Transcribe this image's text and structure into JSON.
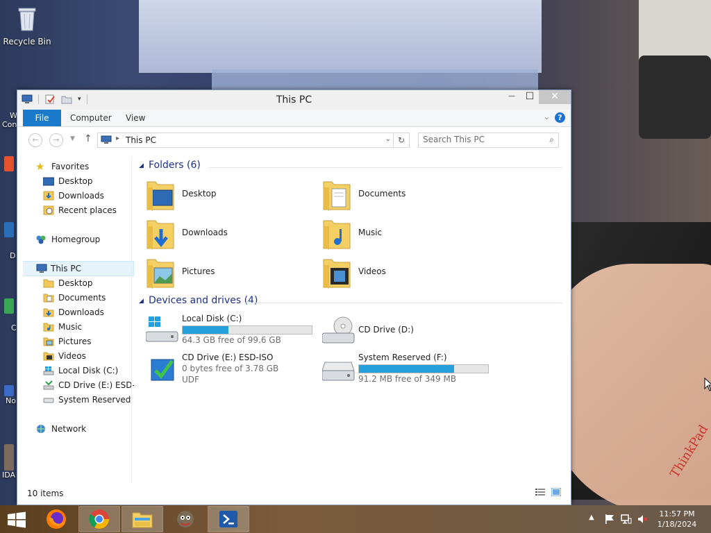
{
  "desktop": {
    "icons": [
      {
        "label": "Recycle Bin"
      }
    ],
    "partial_labels": [
      "W",
      "Con",
      "D",
      "C",
      "No",
      "IDA"
    ],
    "photo_brand": "ThinkPad"
  },
  "window": {
    "title": "This PC",
    "close_glyph": "✕",
    "minimize_glyph": "—",
    "maximize_glyph": "☐"
  },
  "ribbon": {
    "tabs": [
      "File",
      "Computer",
      "View"
    ],
    "help": "?"
  },
  "navbar": {
    "breadcrumb": "This PC",
    "search_placeholder": "Search This PC"
  },
  "nav_pane": {
    "favorites": {
      "label": "Favorites",
      "items": [
        "Desktop",
        "Downloads",
        "Recent places"
      ]
    },
    "homegroup": "Homegroup",
    "this_pc": {
      "label": "This PC",
      "items": [
        "Desktop",
        "Documents",
        "Downloads",
        "Music",
        "Pictures",
        "Videos",
        "Local Disk (C:)",
        "CD Drive (E:) ESD-ISO",
        "System Reserved (F:)"
      ]
    },
    "network": "Network"
  },
  "content": {
    "folders_header": "Folders (6)",
    "folders": [
      "Desktop",
      "Documents",
      "Downloads",
      "Music",
      "Pictures",
      "Videos"
    ],
    "drives_header": "Devices and drives (4)",
    "drives": [
      {
        "name": "Local Disk (C:)",
        "free": "64.3 GB free of 99.6 GB",
        "used_fraction": 0.354
      },
      {
        "name": "CD Drive (D:)"
      },
      {
        "name": "CD Drive (E:) ESD-ISO",
        "free": "0 bytes free of 3.78 GB",
        "fs": "UDF"
      },
      {
        "name": "System Reserved (F:)",
        "free": "91.2 MB free of 349 MB",
        "used_fraction": 0.739
      }
    ]
  },
  "status": {
    "items": "10 items"
  },
  "taskbar": {
    "apps": [
      "Firefox",
      "Chrome",
      "File Explorer",
      "GIMP",
      "PowerShell"
    ],
    "time": "11:57 PM",
    "date": "1/18/2024"
  },
  "colors": {
    "accent": "#1979ca",
    "group_header": "#1e3287",
    "bar_fill": "#26a0da"
  }
}
